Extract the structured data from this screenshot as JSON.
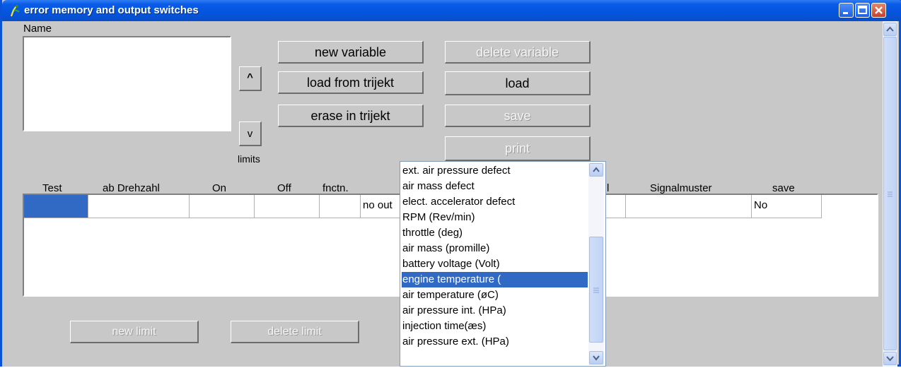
{
  "window": {
    "title": "error memory and output switches"
  },
  "name_label": "Name",
  "buttons": {
    "new_variable": "new variable",
    "load_from_trijekt": "load from trijekt",
    "erase_in_trijekt": "erase in trijekt",
    "delete_variable": "delete variable",
    "load": "load",
    "save": "save",
    "print": "print",
    "up": "^",
    "down": "v",
    "new_limit": "new limit",
    "delete_limit": "delete limit"
  },
  "limits_label": "limits",
  "table": {
    "headers": {
      "test": "Test",
      "ab_drehzahl": "ab Drehzahl",
      "on": "On",
      "off": "Off",
      "fnctn": "fnctn.",
      "col_l": "l",
      "signalmuster": "Signalmuster",
      "save": "save"
    },
    "row": {
      "output": "no out",
      "save": "No"
    }
  },
  "dropdown": {
    "items": [
      "ext. air pressure defect",
      "air mass defect",
      "elect. accelerator defect",
      "RPM (Rev/min)",
      "throttle (deg)",
      "air mass (promille)",
      "battery voltage (Volt)",
      "engine temperature (",
      "air temperature (øC)",
      "air pressure int. (HPa)",
      "injection time(æs)",
      "air pressure ext. (HPa)"
    ],
    "selected": "engine temperature ("
  },
  "colors": {
    "titlebar": "#0a5ce8",
    "selection": "#316ac5",
    "dialog": "#c8c8c8"
  }
}
